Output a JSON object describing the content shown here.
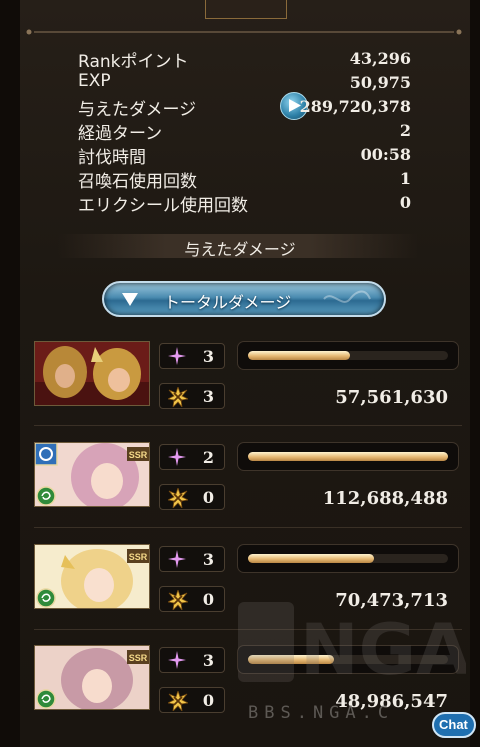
{
  "stats": [
    {
      "label": "Rankポイント",
      "value": "43,296"
    },
    {
      "label": "EXP",
      "value": "50,975"
    },
    {
      "label": "与えたダメージ",
      "value": "289,720,378"
    },
    {
      "label": "経過ターン",
      "value": "2"
    },
    {
      "label": "討伐時間",
      "value": "00:58"
    },
    {
      "label": "召喚石使用回数",
      "value": "1"
    },
    {
      "label": "エリクシール使用回数",
      "value": "0"
    }
  ],
  "section_title": "与えたダメージ",
  "total_button": {
    "label": "トータルダメージ",
    "icon": "chevron-down-icon"
  },
  "characters": [
    {
      "skill_count": "3",
      "ougi_count": "3",
      "damage": "57,561,630",
      "bar_fraction": 0.51,
      "rarity": "",
      "element": "red"
    },
    {
      "skill_count": "2",
      "ougi_count": "0",
      "damage": "112,688,488",
      "bar_fraction": 1.0,
      "rarity": "SSR",
      "element": "wind"
    },
    {
      "skill_count": "3",
      "ougi_count": "0",
      "damage": "70,473,713",
      "bar_fraction": 0.63,
      "rarity": "SSR",
      "element": "wind"
    },
    {
      "skill_count": "3",
      "ougi_count": "0",
      "damage": "48,986,547",
      "bar_fraction": 0.43,
      "rarity": "SSR",
      "element": "wind"
    }
  ],
  "watermark": {
    "logo": "NGA",
    "text": "BBS.NGA.C"
  },
  "chat_badge": "Chat",
  "colors": {
    "bar_fill": "#e6b974",
    "button_blue": "#4a8bb0",
    "text": "#f1ede6"
  }
}
